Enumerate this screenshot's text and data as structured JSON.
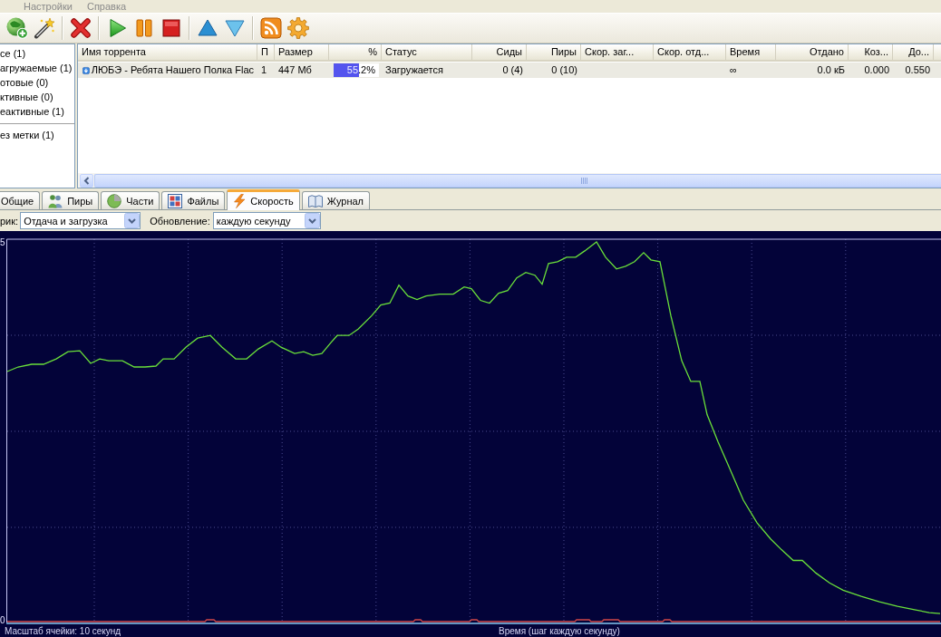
{
  "menu": [
    {
      "label": "Настройки"
    },
    {
      "label": "Справка"
    }
  ],
  "sidebar": {
    "sections": [
      {
        "items": [
          {
            "label": "се (1)"
          },
          {
            "label": "агружаемые (1)"
          },
          {
            "label": "отовые (0)"
          },
          {
            "label": "ктивные (0)"
          },
          {
            "label": "еактивные (1)"
          }
        ]
      },
      {
        "items": [
          {
            "label": "ез метки (1)"
          }
        ]
      }
    ]
  },
  "table": {
    "columns": [
      {
        "label": "Имя торрента"
      },
      {
        "label": "П"
      },
      {
        "label": "Размер"
      },
      {
        "label": "%"
      },
      {
        "label": "Статус"
      },
      {
        "label": "Сиды"
      },
      {
        "label": "Пиры"
      },
      {
        "label": "Скор. заг..."
      },
      {
        "label": "Скор. отд..."
      },
      {
        "label": "Время"
      },
      {
        "label": "Отдано"
      },
      {
        "label": "Коз..."
      },
      {
        "label": "До..."
      }
    ],
    "rows": [
      {
        "selected": true,
        "cells": [
          {
            "kind": "name",
            "text": "ЛЮБЭ - Ребята Нашего Полка Flac"
          },
          {
            "kind": "text",
            "text": "1"
          },
          {
            "kind": "text",
            "text": "447 Мб"
          },
          {
            "kind": "progress",
            "level": 0.552,
            "reading": "55.2%"
          },
          {
            "kind": "text",
            "text": "Загружается"
          },
          {
            "kind": "text",
            "text": "0 (4)"
          },
          {
            "kind": "text",
            "text": "0 (10)"
          },
          {
            "kind": "empty"
          },
          {
            "kind": "empty"
          },
          {
            "kind": "text",
            "text": "∞"
          },
          {
            "kind": "text",
            "text": "0.0 кБ"
          },
          {
            "kind": "text",
            "text": "0.000"
          },
          {
            "kind": "text",
            "text": "0.550"
          }
        ]
      }
    ]
  },
  "tabs": [
    {
      "label": "Общие",
      "selected": false
    },
    {
      "label": "Пиры",
      "selected": false
    },
    {
      "label": "Части",
      "selected": false
    },
    {
      "label": "Файлы",
      "selected": false
    },
    {
      "label": "Скорость",
      "selected": true
    },
    {
      "label": "Журнал",
      "selected": false
    }
  ],
  "graph_controls": [
    {
      "label": "рик:",
      "value": "Отдача и загрузка"
    },
    {
      "label": "Обновление:",
      "value": "каждую секунду"
    }
  ],
  "graph": {
    "top_label": "5",
    "bottom_label": "0",
    "scale_caption": "Масштаб ячейки: 10 секунд",
    "time_caption": "Время (шаг каждую секунду)"
  }
}
